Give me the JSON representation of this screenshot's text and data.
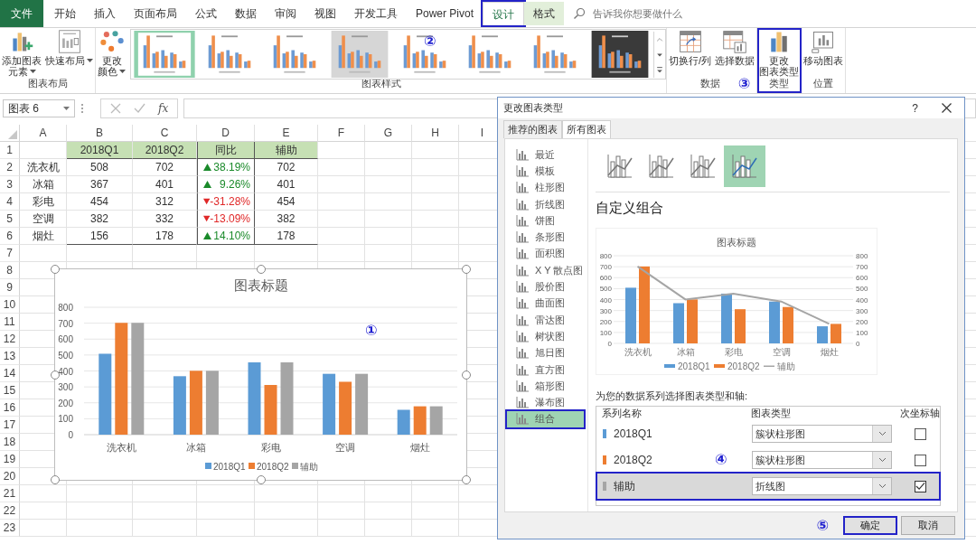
{
  "ribbon_tabs": [
    {
      "label": "文件",
      "kind": "file",
      "selected": false,
      "highlighted": false
    },
    {
      "label": "开始",
      "kind": "normal",
      "selected": false,
      "highlighted": false
    },
    {
      "label": "插入",
      "kind": "normal",
      "selected": false,
      "highlighted": false
    },
    {
      "label": "页面布局",
      "kind": "normal",
      "selected": false,
      "highlighted": false
    },
    {
      "label": "公式",
      "kind": "normal",
      "selected": false,
      "highlighted": false
    },
    {
      "label": "数据",
      "kind": "normal",
      "selected": false,
      "highlighted": false
    },
    {
      "label": "审阅",
      "kind": "normal",
      "selected": false,
      "highlighted": false
    },
    {
      "label": "视图",
      "kind": "normal",
      "selected": false,
      "highlighted": false
    },
    {
      "label": "开发工具",
      "kind": "normal",
      "selected": false,
      "highlighted": false
    },
    {
      "label": "Power Pivot",
      "kind": "normal",
      "selected": false,
      "highlighted": false
    },
    {
      "label": "设计",
      "kind": "contextual",
      "selected": true,
      "highlighted": true
    },
    {
      "label": "格式",
      "kind": "contextual",
      "selected": false,
      "highlighted": false
    }
  ],
  "search": {
    "placeholder": "告诉我你想要做什么"
  },
  "ribbon_groups": [
    {
      "label": "图表布局",
      "highlighted": false,
      "buttons": [
        {
          "kind": "add-element",
          "lines": [
            "添加图表",
            "元素"
          ],
          "has_menu": true
        },
        {
          "kind": "quick-layout",
          "lines": [
            "快速布局"
          ],
          "has_menu": true
        }
      ]
    },
    {
      "label": "图表样式",
      "highlighted": false,
      "annotation": "②",
      "buttons": [
        {
          "kind": "colors",
          "lines": [
            "更改",
            "颜色"
          ],
          "has_menu": true
        }
      ],
      "gallery": [
        {
          "kind": "light",
          "selected": true
        },
        {
          "kind": "light",
          "selected": false
        },
        {
          "kind": "light",
          "selected": false
        },
        {
          "kind": "grey",
          "selected": false
        },
        {
          "kind": "light",
          "selected": false
        },
        {
          "kind": "light",
          "selected": false
        },
        {
          "kind": "light",
          "selected": false
        },
        {
          "kind": "dark",
          "selected": false
        }
      ]
    },
    {
      "label": "数据",
      "highlighted": false,
      "annotation": "③",
      "buttons": [
        {
          "kind": "switch",
          "lines": [
            "切换行/列"
          ],
          "has_menu": false
        },
        {
          "kind": "select-data",
          "lines": [
            "选择数据"
          ],
          "has_menu": false
        }
      ]
    },
    {
      "label": "类型",
      "highlighted": true,
      "buttons": [
        {
          "kind": "change-type",
          "lines": [
            "更改",
            "图表类型"
          ],
          "has_menu": false
        }
      ]
    },
    {
      "label": "位置",
      "highlighted": false,
      "buttons": [
        {
          "kind": "move",
          "lines": [
            "移动图表"
          ],
          "has_menu": false
        }
      ]
    }
  ],
  "formula_bar": {
    "name_box": "图表 6",
    "fx": "fx"
  },
  "sheet": {
    "columns": [
      "A",
      "B",
      "C",
      "D",
      "E",
      "F",
      "G",
      "H",
      "I"
    ],
    "row_numbers": [
      "1",
      "2",
      "3",
      "4",
      "5",
      "6",
      "7",
      "8",
      "9",
      "10",
      "11",
      "12",
      "13",
      "14",
      "15",
      "16",
      "17",
      "18",
      "19",
      "20",
      "21",
      "22",
      "23"
    ],
    "data_table": {
      "header": [
        "2018Q1",
        "2018Q2",
        "同比",
        "辅助"
      ],
      "rows": [
        {
          "name": "洗衣机",
          "q1": "508",
          "q2": "702",
          "change": "38.19%",
          "rising": true,
          "aux": "702"
        },
        {
          "name": "冰箱",
          "q1": "367",
          "q2": "401",
          "change": "9.26%",
          "rising": true,
          "aux": "401"
        },
        {
          "name": "彩电",
          "q1": "454",
          "q2": "312",
          "change": "-31.28%",
          "rising": false,
          "aux": "454"
        },
        {
          "name": "空调",
          "q1": "382",
          "q2": "332",
          "change": "-13.09%",
          "rising": false,
          "aux": "382"
        },
        {
          "name": "烟灶",
          "q1": "156",
          "q2": "178",
          "change": "14.10%",
          "rising": true,
          "aux": "178"
        }
      ]
    }
  },
  "chart": {
    "selected": true,
    "annotation": "①",
    "chart_data": {
      "type": "bar",
      "title": "图表标题",
      "categories": [
        "洗衣机",
        "冰箱",
        "彩电",
        "空调",
        "烟灶"
      ],
      "series": [
        {
          "name": "2018Q1",
          "color": "#5b9bd5",
          "values": [
            508,
            367,
            454,
            382,
            156
          ]
        },
        {
          "name": "2018Q2",
          "color": "#ed7d31",
          "values": [
            702,
            401,
            312,
            332,
            178
          ]
        },
        {
          "name": "辅助",
          "color": "#a5a5a5",
          "values": [
            702,
            401,
            454,
            382,
            178
          ]
        }
      ],
      "ylim": [
        0,
        800
      ],
      "yticks": [
        0,
        100,
        200,
        300,
        400,
        500,
        600,
        700,
        800
      ],
      "grid": true,
      "legend": true
    }
  },
  "dialog": {
    "title": "更改图表类型",
    "help": "?",
    "tabs": [
      {
        "label": "推荐的图表",
        "selected": false
      },
      {
        "label": "所有图表",
        "selected": true
      }
    ],
    "categories": [
      {
        "label": "最近",
        "selected": false,
        "highlighted": false
      },
      {
        "label": "模板",
        "selected": false,
        "highlighted": false
      },
      {
        "label": "柱形图",
        "selected": false,
        "highlighted": false
      },
      {
        "label": "折线图",
        "selected": false,
        "highlighted": false
      },
      {
        "label": "饼图",
        "selected": false,
        "highlighted": false
      },
      {
        "label": "条形图",
        "selected": false,
        "highlighted": false
      },
      {
        "label": "面积图",
        "selected": false,
        "highlighted": false
      },
      {
        "label": "X Y 散点图",
        "selected": false,
        "highlighted": false
      },
      {
        "label": "股价图",
        "selected": false,
        "highlighted": false
      },
      {
        "label": "曲面图",
        "selected": false,
        "highlighted": false
      },
      {
        "label": "雷达图",
        "selected": false,
        "highlighted": false
      },
      {
        "label": "树状图",
        "selected": false,
        "highlighted": false
      },
      {
        "label": "旭日图",
        "selected": false,
        "highlighted": false
      },
      {
        "label": "直方图",
        "selected": false,
        "highlighted": false
      },
      {
        "label": "箱形图",
        "selected": false,
        "highlighted": false
      },
      {
        "label": "瀑布图",
        "selected": false,
        "highlighted": false
      },
      {
        "label": "组合",
        "selected": true,
        "highlighted": true
      }
    ],
    "subtypes": [
      {
        "selected": false
      },
      {
        "selected": false
      },
      {
        "selected": false
      },
      {
        "selected": true
      }
    ],
    "heading": "自定义组合",
    "preview": {
      "chart_data": {
        "type": "bar",
        "title": "图表标题",
        "categories": [
          "洗衣机",
          "冰箱",
          "彩电",
          "空调",
          "烟灶"
        ],
        "series": [
          {
            "name": "2018Q1",
            "color": "#5b9bd5",
            "values": [
              508,
              367,
              454,
              382,
              156
            ]
          },
          {
            "name": "2018Q2",
            "color": "#ed7d31",
            "values": [
              702,
              401,
              312,
              332,
              178
            ]
          },
          {
            "name": "辅助",
            "color": "#a5a5a5",
            "type": "line",
            "values": [
              702,
              401,
              454,
              382,
              178
            ]
          }
        ],
        "ylim": [
          0,
          800
        ],
        "yticks": [
          0,
          100,
          200,
          300,
          400,
          500,
          600,
          700,
          800
        ],
        "y2ticks": [
          0,
          100,
          200,
          300,
          400,
          500,
          600,
          700,
          800
        ],
        "y2lim": [
          0,
          800
        ],
        "grid": true,
        "legend": true
      }
    },
    "series_prompt": "为您的数据系列选择图表类型和轴:",
    "series_table": {
      "columns": [
        "系列名称",
        "图表类型",
        "次坐标轴"
      ],
      "annotation": "④",
      "rows": [
        {
          "name": "2018Q1",
          "color": "#5b9bd5",
          "chart_type": "簇状柱形图",
          "secondary_axis": false,
          "selected": false,
          "highlighted": false
        },
        {
          "name": "2018Q2",
          "color": "#ed7d31",
          "chart_type": "簇状柱形图",
          "secondary_axis": false,
          "selected": false,
          "highlighted": false
        },
        {
          "name": "辅助",
          "color": "#a5a5a5",
          "chart_type": "折线图",
          "secondary_axis": true,
          "selected": true,
          "highlighted": true
        }
      ]
    },
    "footer_annotation": "⑤",
    "buttons": [
      {
        "label": "确定",
        "highlighted": true
      },
      {
        "label": "取消",
        "highlighted": false
      }
    ]
  }
}
